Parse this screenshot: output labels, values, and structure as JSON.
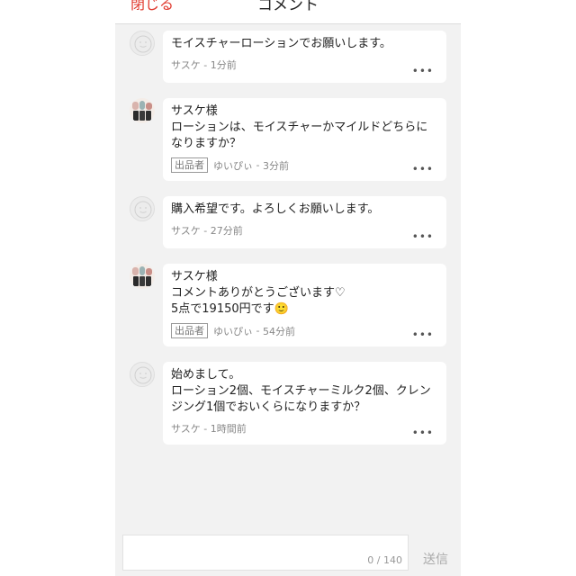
{
  "header": {
    "close_label": "閉じる",
    "title": "コメント"
  },
  "comments": [
    {
      "text": "モイスチャーローションでお願いします。",
      "author": "サスケ",
      "time": "1分前",
      "is_seller": false
    },
    {
      "text": "サスケ様\nローションは、モイスチャーかマイルドどちらに\nなりますか？",
      "author": "ゆいぴぃ",
      "time": "3分前",
      "is_seller": true,
      "badge": "出品者"
    },
    {
      "text": "購入希望です。よろしくお願いします。",
      "author": "サスケ",
      "time": "27分前",
      "is_seller": false
    },
    {
      "text": "サスケ様\nコメントありがとうございます♡\n5点で19150円です🙂",
      "author": "ゆいぴぃ",
      "time": "54分前",
      "is_seller": true,
      "badge": "出品者"
    },
    {
      "text": "始めまして。\nローション2個、モイスチャーミルク2個、クレン\nジング1個でおいくらになりますか？",
      "author": "サスケ",
      "time": "1時間前",
      "is_seller": false
    }
  ],
  "meta_separator": " - ",
  "more_icon": "•••",
  "footer": {
    "char_count": "0 / 140",
    "send_label": "送信"
  },
  "colors": {
    "close": "#e03a2f",
    "background": "#f2f2f2"
  }
}
